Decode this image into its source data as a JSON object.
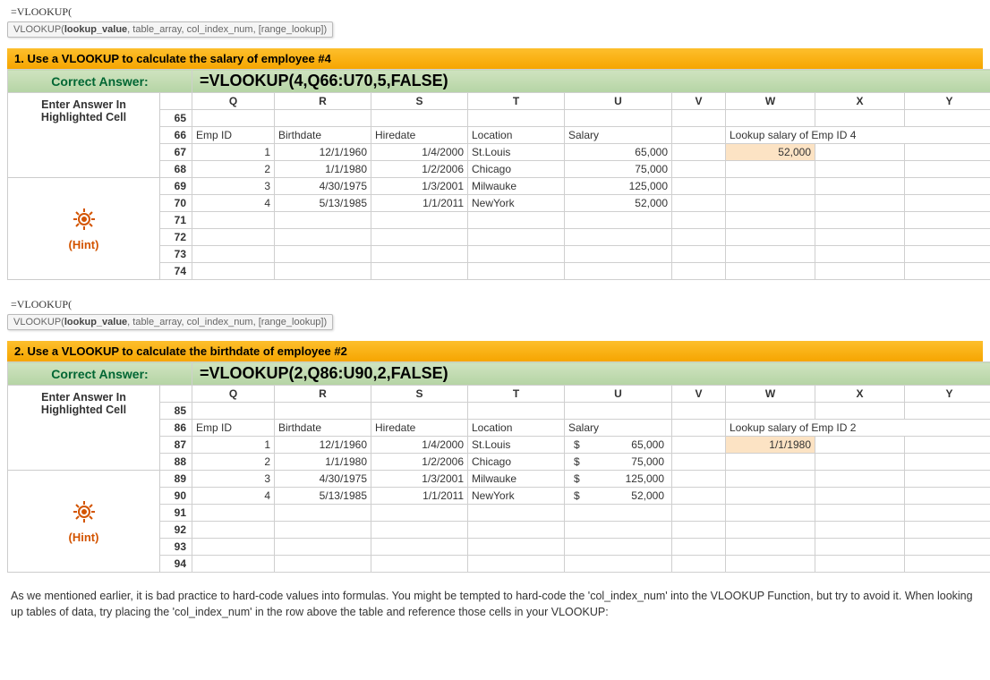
{
  "formula_start": "=VLOOKUP(",
  "tooltip_fn": "VLOOKUP(",
  "tooltip_bold": "lookup_value",
  "tooltip_rest": ", table_array, col_index_num, [range_lookup])",
  "ex1": {
    "title": "1. Use a VLOOKUP to calculate the salary of employee #4",
    "correct_label": "Correct Answer:",
    "correct_formula": "=VLOOKUP(4,Q66:U70,5,FALSE)",
    "left_line1": "Enter Answer In",
    "left_line2": "Highlighted Cell",
    "hint_label": "(Hint)",
    "col_letters": [
      "Q",
      "R",
      "S",
      "T",
      "U",
      "V",
      "W",
      "X",
      "Y"
    ],
    "row_nums": [
      "65",
      "66",
      "67",
      "68",
      "69",
      "70",
      "71",
      "72",
      "73",
      "74"
    ],
    "headers": [
      "Emp ID",
      "Birthdate",
      "Hiredate",
      "Location",
      "Salary"
    ],
    "data": [
      [
        "1",
        "12/1/1960",
        "1/4/2000",
        "St.Louis",
        "65,000"
      ],
      [
        "2",
        "1/1/1980",
        "1/2/2006",
        "Chicago",
        "75,000"
      ],
      [
        "3",
        "4/30/1975",
        "1/3/2001",
        "Milwauke",
        "125,000"
      ],
      [
        "4",
        "5/13/1985",
        "1/1/2011",
        "NewYork",
        "52,000"
      ]
    ],
    "lookup_label": "Lookup salary of Emp ID 4",
    "lookup_result": "52,000"
  },
  "ex2": {
    "title": "2. Use a VLOOKUP to calculate the birthdate of employee #2",
    "correct_label": "Correct Answer:",
    "correct_formula": "=VLOOKUP(2,Q86:U90,2,FALSE)",
    "left_line1": "Enter Answer In",
    "left_line2": "Highlighted Cell",
    "hint_label": "(Hint)",
    "col_letters": [
      "Q",
      "R",
      "S",
      "T",
      "U",
      "V",
      "W",
      "X",
      "Y"
    ],
    "row_nums": [
      "85",
      "86",
      "87",
      "88",
      "89",
      "90",
      "91",
      "92",
      "93",
      "94"
    ],
    "headers": [
      "Emp ID",
      "Birthdate",
      "Hiredate",
      "Location",
      "Salary"
    ],
    "data": [
      [
        "1",
        "12/1/1960",
        "1/4/2000",
        "St.Louis",
        "65,000"
      ],
      [
        "2",
        "1/1/1980",
        "1/2/2006",
        "Chicago",
        "75,000"
      ],
      [
        "3",
        "4/30/1975",
        "1/3/2001",
        "Milwauke",
        "125,000"
      ],
      [
        "4",
        "5/13/1985",
        "1/1/2011",
        "NewYork",
        "52,000"
      ]
    ],
    "currency_symbol": "$",
    "lookup_label": "Lookup salary of Emp ID 2",
    "lookup_result": "1/1/1980"
  },
  "note_text": "As we mentioned earlier, it is bad practice to hard-code values into formulas. You might be tempted to hard-code the 'col_index_num' into the VLOOKUP Function, but try to avoid it. When looking up tables of data, try placing the 'col_index_num' in the row above the table and reference those cells in your VLOOKUP:"
}
